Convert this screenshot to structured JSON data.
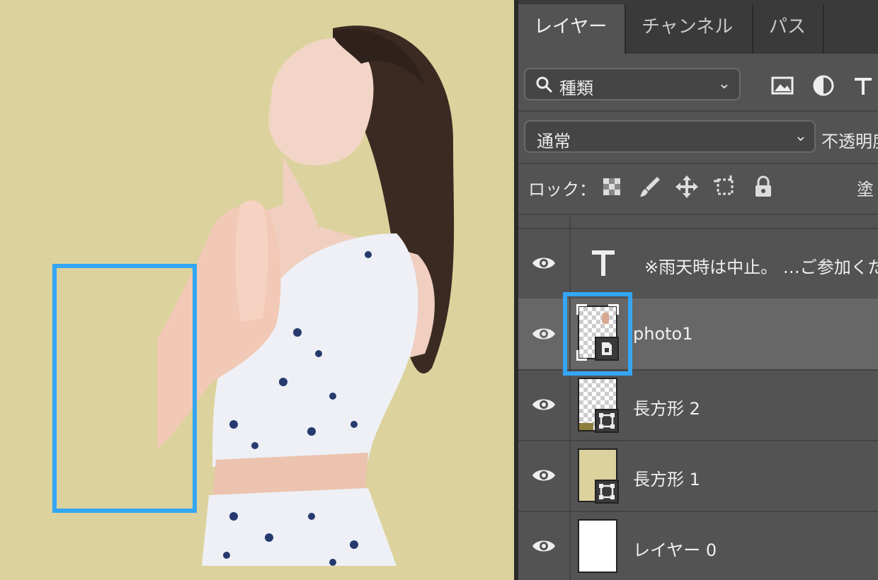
{
  "tabs": [
    "レイヤー",
    "チャンネル",
    "パス"
  ],
  "filter": {
    "label": "種類",
    "icons": [
      "image-filter-icon",
      "adjustment-filter-icon",
      "type-filter-icon"
    ]
  },
  "blend": {
    "mode": "通常",
    "opacity_label": "不透明度"
  },
  "lock": {
    "label": "ロック：",
    "fill_label": "塗"
  },
  "layers": [
    {
      "name": "※雨天時は中止。 …ご参加くだ",
      "type": "text",
      "visible": true,
      "selected": false
    },
    {
      "name": "photo1",
      "type": "smart-object",
      "visible": true,
      "selected": true
    },
    {
      "name": "長方形 2",
      "type": "shape",
      "visible": true,
      "selected": false
    },
    {
      "name": "長方形 1",
      "type": "shape",
      "visible": true,
      "selected": false
    },
    {
      "name": "レイヤー 0",
      "type": "pixel",
      "visible": true,
      "selected": false
    }
  ],
  "colors": {
    "canvas_bg": "#dcd29d",
    "highlight": "#34a6f4",
    "panel_bg": "#535353"
  }
}
